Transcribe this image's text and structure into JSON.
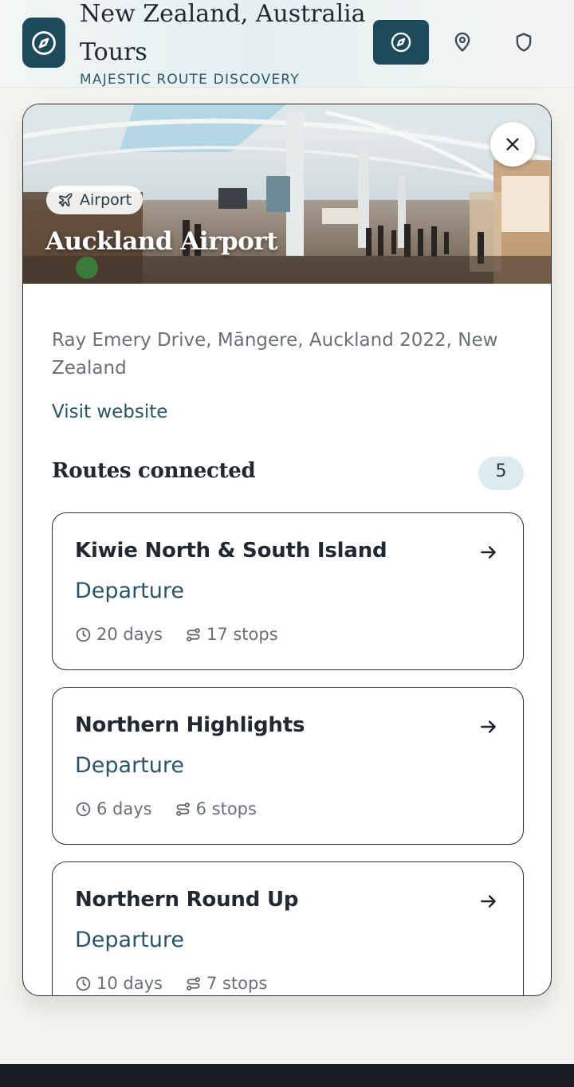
{
  "header": {
    "title": "New Zealand, Australia Tours",
    "subtitle": "MAJESTIC ROUTE DISCOVERY",
    "logo_icon": "compass-icon",
    "nav": [
      {
        "icon": "compass-icon",
        "active": true
      },
      {
        "icon": "map-pin-icon",
        "active": false
      },
      {
        "icon": "shield-icon",
        "active": false
      }
    ]
  },
  "place": {
    "type": "Airport",
    "type_icon": "plane-icon",
    "name": "Auckland Airport",
    "address": "Ray Emery Drive, Māngere, Auckland 2022, New Zealand",
    "website_label": "Visit website"
  },
  "routes": {
    "heading": "Routes connected",
    "count": "5",
    "items": [
      {
        "name": "Kiwie North & South Island",
        "kind": "Departure",
        "duration": "20 days",
        "stops": "17 stops"
      },
      {
        "name": "Northern Highlights",
        "kind": "Departure",
        "duration": "6 days",
        "stops": "6 stops"
      },
      {
        "name": "Northern Round Up",
        "kind": "Departure",
        "duration": "10 days",
        "stops": "7 stops"
      }
    ]
  },
  "colors": {
    "brand": "#1e4a5a",
    "link": "#2b5566",
    "badge_bg": "#dcebef",
    "footer": "#181c24"
  }
}
